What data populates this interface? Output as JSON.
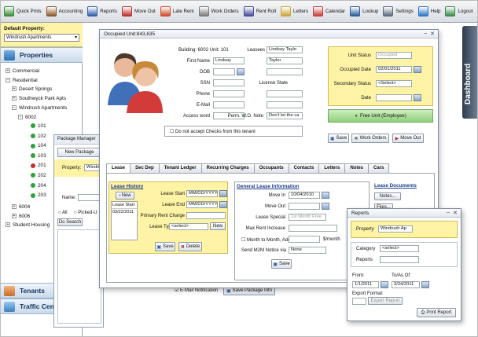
{
  "toolbar": [
    {
      "label": "Quick Pmts",
      "icon": "cash-icon",
      "color": "#3b8a3a"
    },
    {
      "label": "Accounting",
      "icon": "accounting-icon",
      "color": "#8a5a2b"
    },
    {
      "label": "Reports",
      "icon": "reports-icon",
      "color": "#2f5fa8"
    },
    {
      "label": "Move Out",
      "icon": "move-out-icon",
      "color": "#b8322a"
    },
    {
      "label": "Late Rent",
      "icon": "late-rent-icon",
      "color": "#d04a2a"
    },
    {
      "label": "Work Orders",
      "icon": "work-orders-icon",
      "color": "#7a7a7a"
    },
    {
      "label": "Rent Roll",
      "icon": "rent-roll-icon",
      "color": "#4a4a9a"
    },
    {
      "label": "Letters",
      "icon": "letters-icon",
      "color": "#c9a53a"
    },
    {
      "label": "Calendar",
      "icon": "calendar-icon",
      "color": "#c73b3b"
    },
    {
      "label": "Lookup",
      "icon": "lookup-icon",
      "color": "#2a5d9a"
    },
    {
      "label": "Settings",
      "icon": "settings-icon",
      "color": "#5b6b7c"
    },
    {
      "label": "Help",
      "icon": "help-icon",
      "color": "#2d74c4"
    },
    {
      "label": "Logout",
      "icon": "logout-icon",
      "color": "#3a8a4a"
    }
  ],
  "sidebar": {
    "default_property_label": "Default Property:",
    "default_property_value": "Windrush Apartments",
    "properties_header": "Properties",
    "tenants_header": "Tenants",
    "traffic_header": "Traffic Center",
    "tree": {
      "commercial": "Commercial",
      "residential": "Residential",
      "desert_springs": "Desert Springs",
      "southwyck": "Southwyck Park Apts",
      "windrush": "Windrush Apartments",
      "bldg_6002": "6002",
      "units": [
        "101",
        "102",
        "104",
        "103",
        "201",
        "202",
        "204",
        "203"
      ],
      "unit_status": [
        "green",
        "green",
        "green",
        "green",
        "red",
        "green",
        "green",
        "green"
      ],
      "bldg_6004": "6004",
      "bldg_6006": "6006",
      "student_housing": "Student Housing"
    }
  },
  "package_manager": {
    "title": "Package Manager",
    "new_package": "New Package",
    "property_label": "Property:",
    "property_value": "Windrush",
    "name_label": "Name:",
    "all_label": "All",
    "picked_up_label": "Picked-U",
    "do_search": "Do Search",
    "email_notification": "E-Mail Notification",
    "save_package_info": "Save Package Info"
  },
  "dialog": {
    "title": "Occupied Unit:843,635",
    "building_unit": "Building: 6002  Unit: 101",
    "labels": {
      "first_name": "First Name",
      "dob": "DOB",
      "ssn": "SSN",
      "phone": "Phone",
      "email": "E-Mail",
      "access_word": "Access word",
      "leasees": "Leasees",
      "last": "Last",
      "license_num": "License #",
      "license_state": "License State",
      "cell_num": "Cell #",
      "work_num": "Work #",
      "perm_wo_note": "Perm. W.O. Note"
    },
    "values": {
      "first_name": "Lindsay",
      "last": "Taylor",
      "leasees": "Lindsay Taylo",
      "perm_wo_note": "Don't let the ca"
    },
    "no_checks_label": "Do not accept Checks from this tenant",
    "status": {
      "unit_status_label": "Unit Status",
      "unit_status_value": "Occupied",
      "occupied_date_label": "Occupied Date",
      "occupied_date_value": "02/01/2011",
      "secondary_status_label": "Secondary Status",
      "secondary_status_value": "<Select>",
      "date_label": "Date"
    },
    "free_unit_button": "Free Unit (Employee)",
    "save_button": "Save",
    "work_orders_button": "Work Orders",
    "move_out_button": "Move Out",
    "tabs": [
      "Lease",
      "Sec Dep",
      "Tenant Ledger",
      "Recurring Charges",
      "Occupants",
      "Contacts",
      "Letters",
      "Notes",
      "Cars"
    ],
    "lease": {
      "history_title": "Lease History",
      "new_button": "New",
      "lease_start_col": "Lease Start",
      "history_row": "03/22/2011",
      "lease_start_label": "Lease Start",
      "lease_start_value": "MM/DD/YYYY",
      "lease_end_label": "Lease End",
      "lease_end_value": "MM/DD/YYYY",
      "primary_rent_label": "Primary Rent Charge",
      "lease_type_label": "Lease Type",
      "lease_type_value": "<select>",
      "new_type_button": "New",
      "save_button": "Save",
      "delete_button": "Delete"
    },
    "general": {
      "title": "General Lease Information",
      "move_in_label": "Move In",
      "move_in_value": "10/04/2010",
      "move_out_label": "Move Out",
      "lease_special_label": "Lease Special",
      "lease_special_value": "1st Month Free",
      "max_rent_label": "Max Rent Increase",
      "m2m_label": "Month to Month, Add",
      "per_month": "$/month",
      "m2m_notice_label": "Send M2M Notice via",
      "m2m_notice_value": "None",
      "save_button": "Save"
    },
    "lease_docs": {
      "title": "Lease Documents",
      "notes_button": "Notes...",
      "files_button": "Files..."
    }
  },
  "reports": {
    "title": "Reports",
    "property_label": "Property",
    "property_value": "Windrush Ap",
    "category_label": "Category",
    "category_value": "<select>",
    "reports_label": "Reports",
    "from_label": "From:",
    "from_value": "1/1/2011",
    "to_label": "To/As Of:",
    "to_value": "3/24/2011",
    "export_format_label": "Export Format:",
    "export_report": "Export Report",
    "print_report": "Print Report"
  },
  "dashboard_label": "Dashboard",
  "colors": {
    "yellow_panel": "#fff3a6",
    "accent_blue": "#1a3d8a",
    "free_unit_green": "#8fd07c"
  }
}
